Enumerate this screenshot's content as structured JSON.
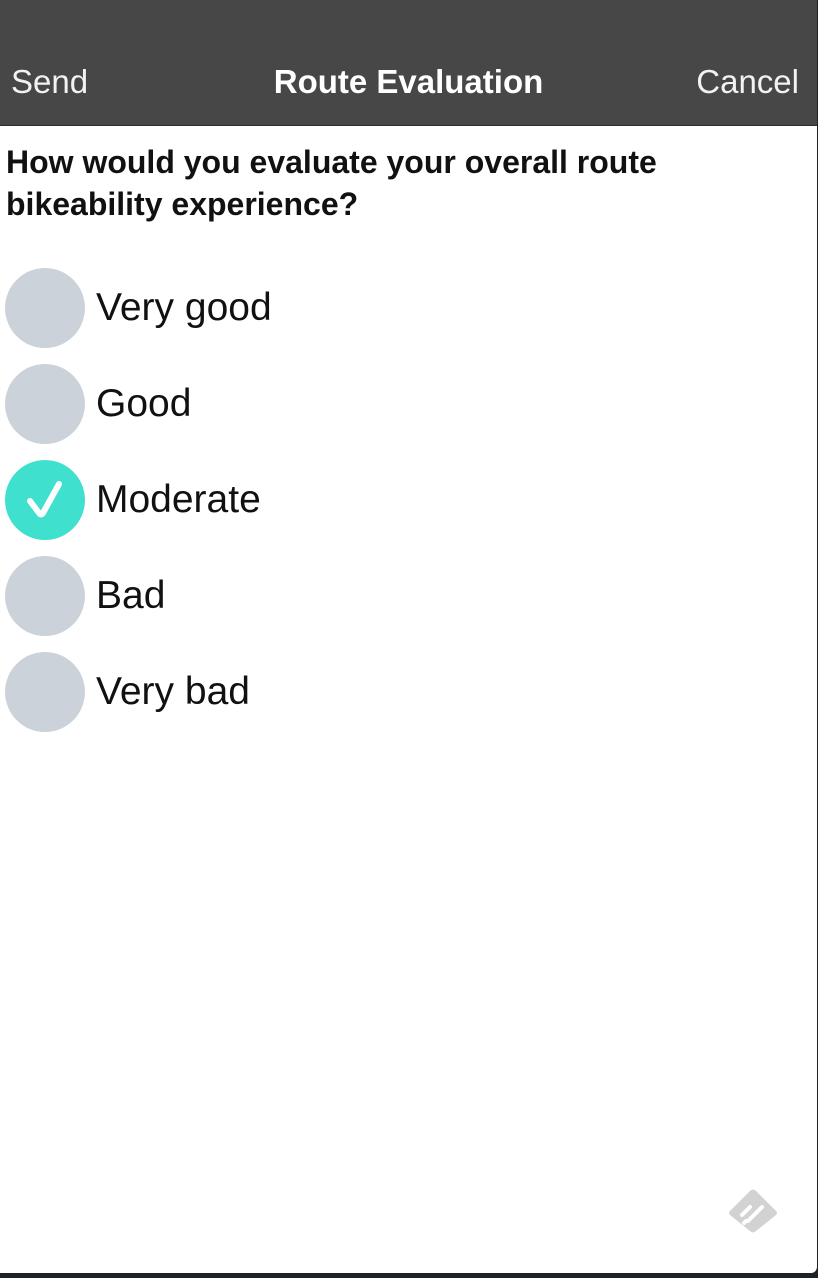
{
  "header": {
    "left_button": "Send",
    "title": "Route Evaluation",
    "right_button": "Cancel"
  },
  "question": "How would you evaluate your overall route bikeability experience?",
  "options": [
    {
      "label": "Very good",
      "selected": false
    },
    {
      "label": "Good",
      "selected": false
    },
    {
      "label": "Moderate",
      "selected": true
    },
    {
      "label": "Bad",
      "selected": false
    },
    {
      "label": "Very bad",
      "selected": false
    }
  ],
  "colors": {
    "navbar": "#474747",
    "radio_unselected": "#ccd2da",
    "radio_selected": "#40e0cf"
  },
  "icons": {
    "selected_mark": "checkmark-icon",
    "footer": "feedback-icon"
  }
}
